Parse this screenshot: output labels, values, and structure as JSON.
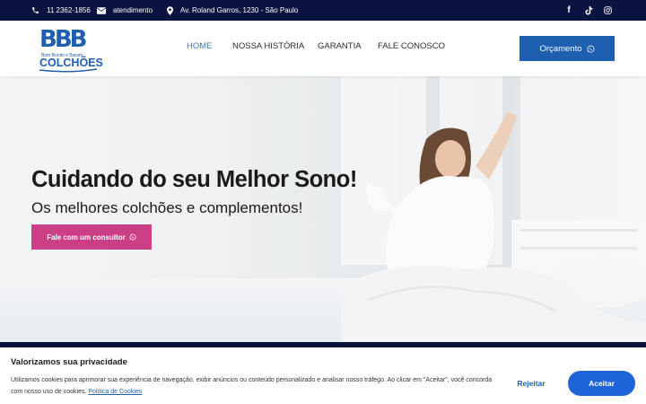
{
  "topbar": {
    "phone": "11 2362-1856",
    "email": "atendimento",
    "address": "Av. Roland Garros, 1230 - São Paulo",
    "social_icons": [
      "facebook-icon",
      "tiktok-icon",
      "instagram-icon"
    ]
  },
  "logo": {
    "letters": "BBB",
    "tagline": "Bom Bonito e Barato",
    "brand": "COLCHÕES"
  },
  "nav": {
    "items": [
      {
        "label": "HOME",
        "active": true
      },
      {
        "label": "NOSSA HISTÓRIA",
        "active": false
      },
      {
        "label": "GARANTIA",
        "active": false
      },
      {
        "label": "FALE CONOSCO",
        "active": false
      }
    ],
    "cta_label": "Orçamento"
  },
  "hero": {
    "title": "Cuidando do seu Melhor Sono!",
    "subtitle": "Os melhores colchões e complementos!",
    "button_label": "Fale com um consultor"
  },
  "cookie": {
    "title": "Valorizamos sua privacidade",
    "text": "Utilizamos cookies para aprimorar sua experiência de navegação, exibir anúncios ou conteúdo personalizado e analisar nosso tráfego. Ao clicar em \"Aceitar\", você concorda com nosso uso de cookies.",
    "policy_link": "Política de Cookies",
    "reject_label": "Rejeitar",
    "accept_label": "Aceitar"
  },
  "colors": {
    "topbar_bg": "#0b1340",
    "brand_blue": "#1f5fb0",
    "nav_active": "#3a79b9",
    "hero_button": "#cc3f86",
    "accept_button": "#1f63d8"
  }
}
